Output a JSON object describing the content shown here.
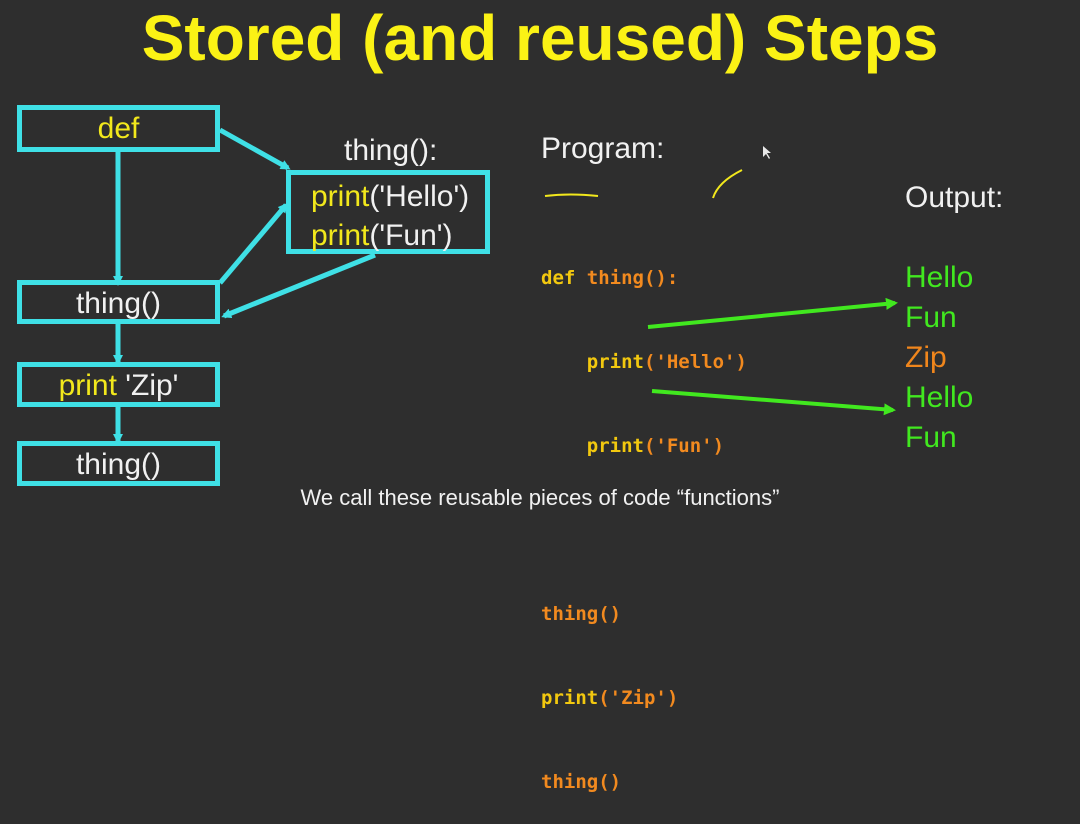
{
  "title": "Stored (and reused) Steps",
  "flow": {
    "def_box": "def",
    "call1_box": "thing()",
    "print_box_keyword": "print",
    "print_box_arg": " 'Zip'",
    "call2_box": "thing()",
    "func_name_label": "thing():",
    "func_body": [
      {
        "keyword": "print",
        "arg": "('Hello')"
      },
      {
        "keyword": "print",
        "arg": "('Fun')"
      }
    ]
  },
  "program": {
    "label": "Program:",
    "lines": [
      {
        "indent": "",
        "keyword": "def ",
        "rest": "thing():"
      },
      {
        "indent": "    ",
        "keyword": "print",
        "rest": "('Hello')"
      },
      {
        "indent": "    ",
        "keyword": "print",
        "rest": "('Fun')"
      },
      {
        "indent": "",
        "keyword": "",
        "rest": ""
      },
      {
        "indent": "",
        "keyword": "",
        "rest": "thing()"
      },
      {
        "indent": "",
        "keyword": "print",
        "rest": "('Zip')"
      },
      {
        "indent": "",
        "keyword": "",
        "rest": "thing()"
      }
    ]
  },
  "output": {
    "label": "Output:",
    "lines": [
      {
        "text": "Hello",
        "color": "#41e81f"
      },
      {
        "text": "Fun",
        "color": "#41e81f"
      },
      {
        "text": "Zip",
        "color": "#f0861c"
      },
      {
        "text": "Hello",
        "color": "#41e81f"
      },
      {
        "text": "Fun",
        "color": "#41e81f"
      }
    ]
  },
  "caption": "We call these reusable pieces of code “functions”",
  "colors": {
    "title": "#fbf215",
    "box_border": "#3fe0e6",
    "arrow_green": "#41e81f",
    "keyword": "#f2c80f",
    "code": "#f28a1f"
  }
}
